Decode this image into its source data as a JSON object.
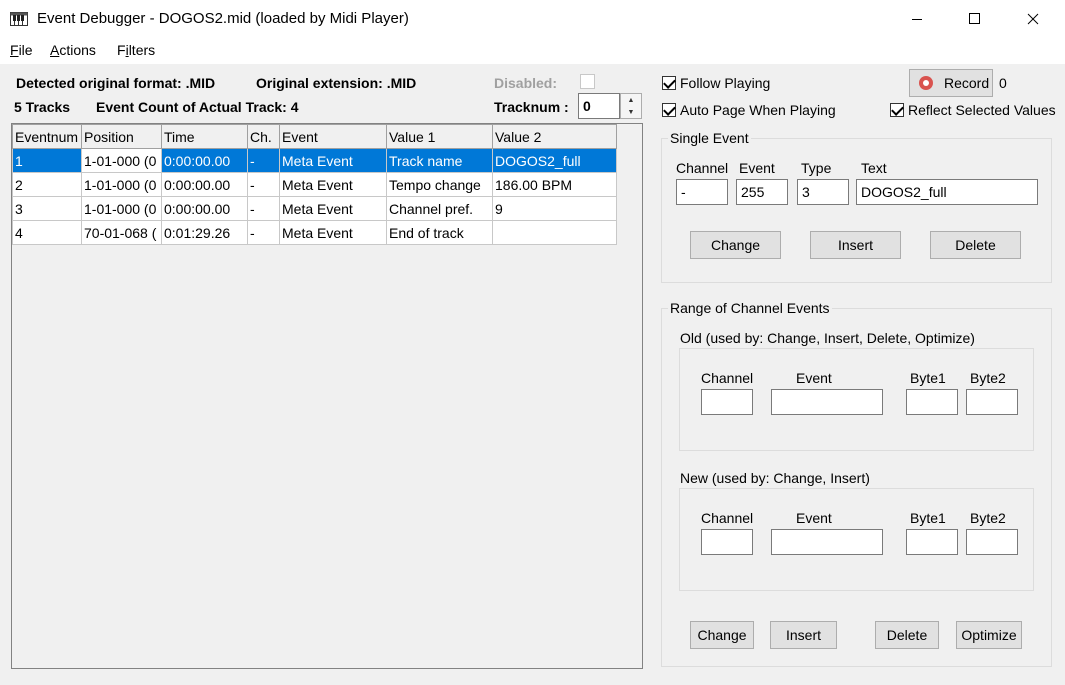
{
  "window": {
    "title": "Event Debugger - DOGOS2.mid (loaded by Midi Player)"
  },
  "menu": {
    "file": {
      "label": "File",
      "hotkey": "F",
      "rest": "ile"
    },
    "actions": {
      "label": "Actions",
      "hotkey": "A",
      "rest": "ctions"
    },
    "filters": {
      "label": "Filters",
      "prefix": "F",
      "hotkey": "i",
      "rest": "lters"
    }
  },
  "info": {
    "detected_format_label": "Detected original format: .MID",
    "original_extension_label": "Original extension: .MID",
    "disabled_label": "Disabled:",
    "tracks_label": "5 Tracks",
    "event_count_label": "Event Count of Actual Track: 4",
    "tracknum_label": "Tracknum :",
    "tracknum_value": "0"
  },
  "grid": {
    "headers": [
      "Eventnum",
      "Position",
      "Time",
      "Ch.",
      "Event",
      "Value 1",
      "Value 2"
    ],
    "rows": [
      [
        "1",
        "1-01-000  (0",
        "0:00:00.00",
        "-",
        "Meta Event",
        "Track name",
        "DOGOS2_full"
      ],
      [
        "2",
        "1-01-000  (0",
        "0:00:00.00",
        "-",
        "Meta Event",
        "Tempo change",
        "186.00 BPM"
      ],
      [
        "3",
        "1-01-000  (0",
        "0:00:00.00",
        "-",
        "Meta Event",
        "Channel pref.",
        "9"
      ],
      [
        "4",
        "70-01-068  (",
        "0:01:29.26",
        "-",
        "Meta Event",
        "End of track",
        ""
      ]
    ],
    "selected_row": 1
  },
  "options": {
    "follow_playing": {
      "label": "Follow Playing",
      "checked": true
    },
    "auto_page": {
      "label": "Auto Page When Playing",
      "checked": true
    },
    "reflect_selected": {
      "label": "Reflect Selected Values",
      "checked": true
    },
    "record_label": "Record",
    "record_count": "0"
  },
  "single_event": {
    "title": "Single Event",
    "channel_label": "Channel",
    "event_label": "Event",
    "type_label": "Type",
    "text_label": "Text",
    "channel_value": "-",
    "event_value": "255",
    "type_value": "3",
    "text_value": "DOGOS2_full",
    "change_label": "Change",
    "insert_label": "Insert",
    "delete_label": "Delete"
  },
  "range": {
    "title": "Range of Channel Events",
    "old_title": "Old  (used by: Change, Insert, Delete, Optimize)",
    "new_title": "New  (used by: Change, Insert)",
    "channel_label": "Channel",
    "event_label": "Event",
    "byte1_label": "Byte1",
    "byte2_label": "Byte2",
    "change_label": "Change",
    "insert_label": "Insert",
    "delete_label": "Delete",
    "optimize_label": "Optimize"
  },
  "colors": {
    "selection": "#0078d7",
    "record_icon": "#d9534f"
  }
}
